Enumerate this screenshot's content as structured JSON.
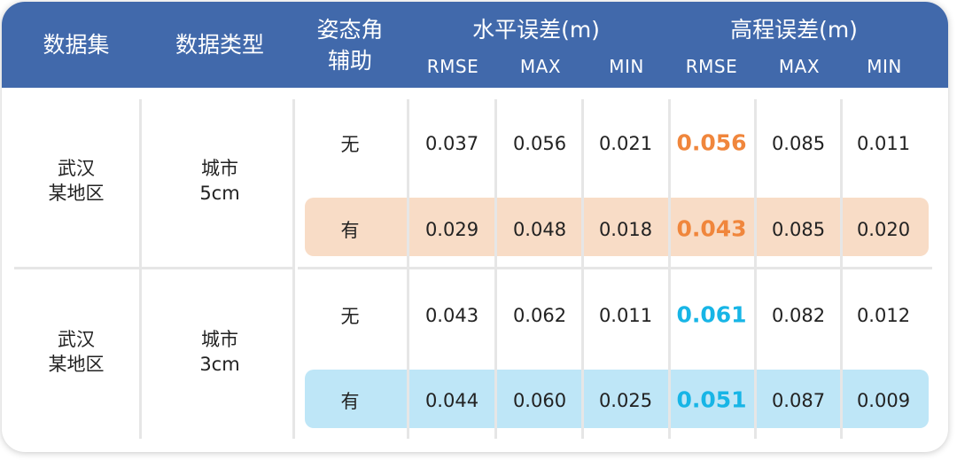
{
  "header": {
    "dataset": "数据集",
    "data_type": "数据类型",
    "attitude_line1": "姿态角",
    "attitude_line2": "辅助",
    "horizontal_error": "水平误差(m)",
    "elevation_error": "高程误差(m)",
    "metrics": [
      "RMSE",
      "MAX",
      "MIN",
      "RMSE",
      "MAX",
      "MIN"
    ]
  },
  "groups": [
    {
      "dataset_line1": "武汉",
      "dataset_line2": "某地区",
      "type_line1": "城市",
      "type_line2": "5cm",
      "highlight_color": "#f0863c",
      "band_color": "#f8dcc6",
      "rows": [
        {
          "attitude": "无",
          "h_rmse": "0.037",
          "h_max": "0.056",
          "h_min": "0.021",
          "v_rmse": "0.056",
          "v_max": "0.085",
          "v_min": "0.011"
        },
        {
          "attitude": "有",
          "h_rmse": "0.029",
          "h_max": "0.048",
          "h_min": "0.018",
          "v_rmse": "0.043",
          "v_max": "0.085",
          "v_min": "0.020"
        }
      ]
    },
    {
      "dataset_line1": "武汉",
      "dataset_line2": "某地区",
      "type_line1": "城市",
      "type_line2": "3cm",
      "highlight_color": "#17b5e6",
      "band_color": "#bee6f7",
      "rows": [
        {
          "attitude": "无",
          "h_rmse": "0.043",
          "h_max": "0.062",
          "h_min": "0.011",
          "v_rmse": "0.061",
          "v_max": "0.082",
          "v_min": "0.012"
        },
        {
          "attitude": "有",
          "h_rmse": "0.044",
          "h_max": "0.060",
          "h_min": "0.025",
          "v_rmse": "0.051",
          "v_max": "0.087",
          "v_min": "0.009"
        }
      ]
    }
  ],
  "colors": {
    "header_bg": "#4169ab"
  }
}
